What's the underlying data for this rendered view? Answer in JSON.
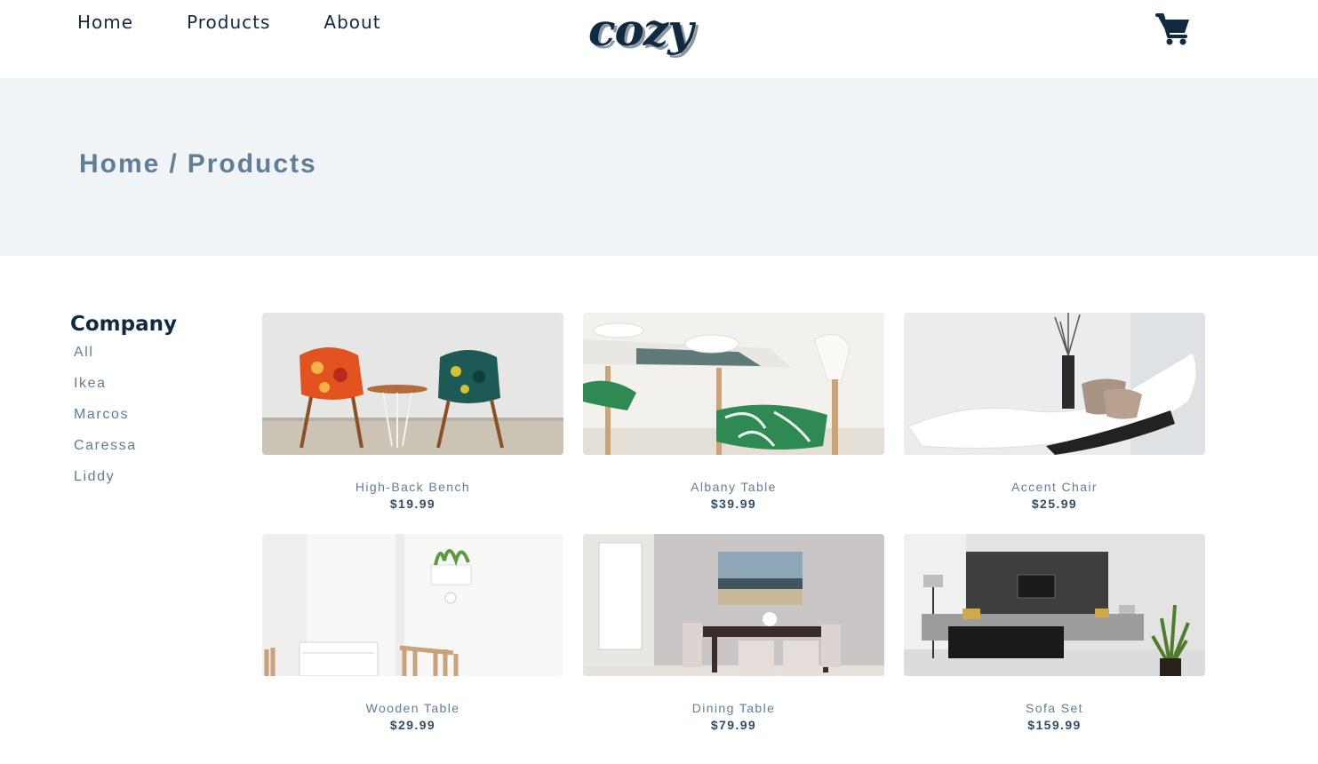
{
  "nav": {
    "links": [
      "Home",
      "Products",
      "About"
    ],
    "logo": "cozy",
    "cart_icon": "shopping-cart-icon"
  },
  "hero": {
    "crumb_home": "Home",
    "separator": "/",
    "crumb_current": "Products"
  },
  "filters": {
    "title": "Company",
    "companies": [
      "All",
      "Ikea",
      "Marcos",
      "Caressa",
      "Liddy"
    ]
  },
  "products": [
    {
      "name": "High-Back Bench",
      "price": "$19.99"
    },
    {
      "name": "Albany Table",
      "price": "$39.99"
    },
    {
      "name": "Accent Chair",
      "price": "$25.99"
    },
    {
      "name": "Wooden Table",
      "price": "$29.99"
    },
    {
      "name": "Dining Table",
      "price": "$79.99"
    },
    {
      "name": "Sofa Set",
      "price": "$159.99"
    }
  ],
  "colors": {
    "primary_dark": "#102a42",
    "muted_text": "#617d98",
    "hero_bg": "#f0f4f7"
  }
}
